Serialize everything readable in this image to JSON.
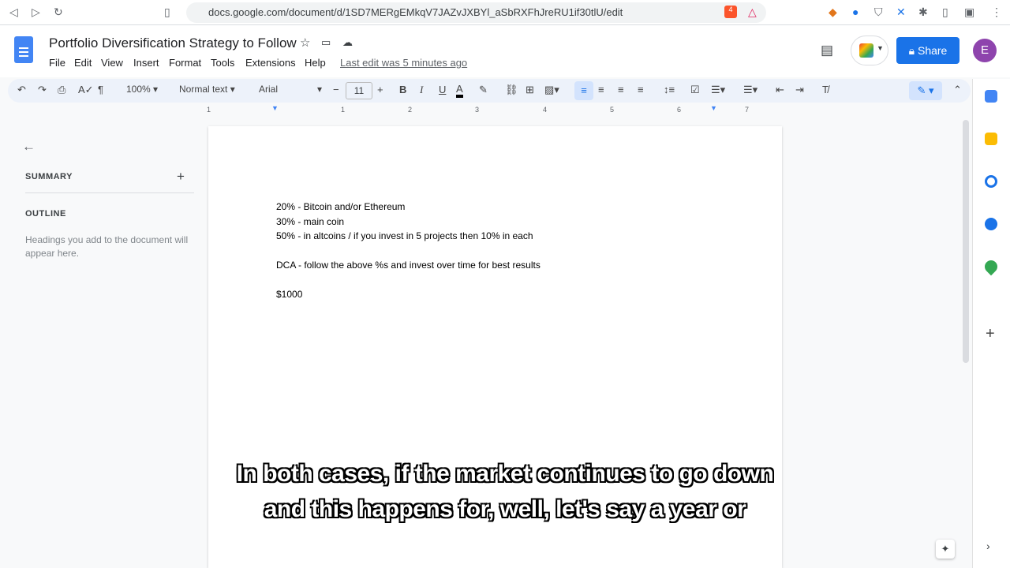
{
  "browser": {
    "url": "docs.google.com/document/d/1SD7MERgEMkqV7JAZvJXBYl_aSbRXFhJreRU1if30tlU/edit",
    "brave_badge": "4"
  },
  "doc": {
    "title": "Portfolio Diversification Strategy to Follow",
    "menu": [
      "File",
      "Edit",
      "View",
      "Insert",
      "Format",
      "Tools",
      "Extensions",
      "Help"
    ],
    "last_edit": "Last edit was 5 minutes ago",
    "share_label": "Share",
    "avatar_initial": "E"
  },
  "toolbar": {
    "zoom": "100%",
    "style": "Normal text",
    "font": "Arial",
    "font_size": "11",
    "bold": "B",
    "italic": "I",
    "underline": "U",
    "text_color": "A"
  },
  "ruler": [
    "1",
    "1",
    "2",
    "3",
    "4",
    "5",
    "6",
    "7"
  ],
  "outline": {
    "summary": "SUMMARY",
    "outline": "OUTLINE",
    "hint": "Headings you add to the document will appear here."
  },
  "body": [
    "20% - Bitcoin and/or Ethereum",
    "30% - main coin",
    "50% - in altcoins / if you invest in 5 projects then 10% in each",
    "DCA - follow the above %s and invest over time for best results",
    "$1000"
  ],
  "captions": [
    "In both cases, if the market continues to go down",
    "and this happens for, well, let's say a year or"
  ]
}
